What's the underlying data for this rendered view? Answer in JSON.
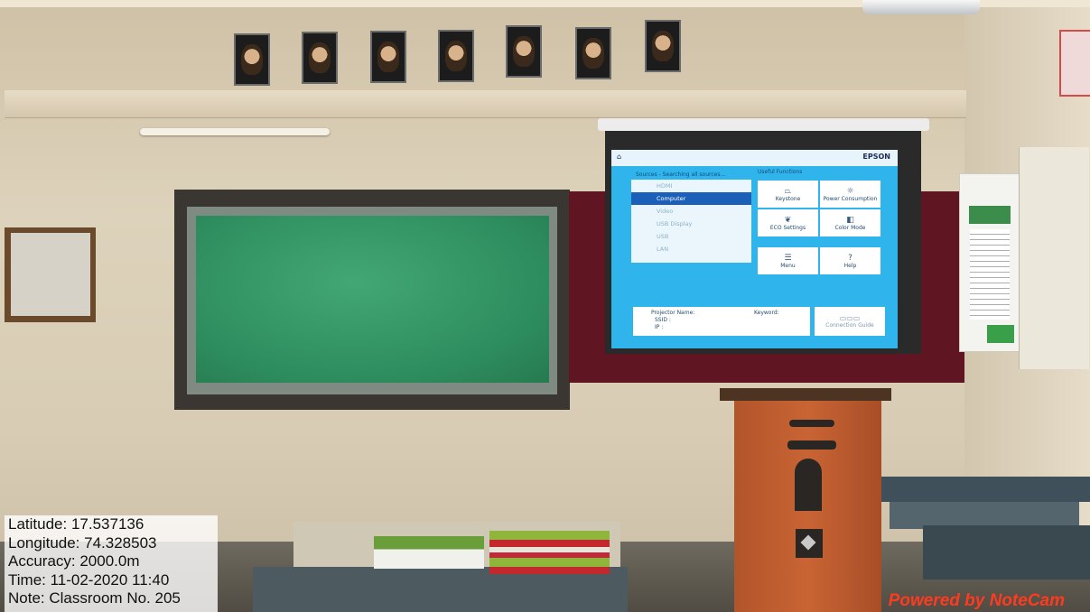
{
  "geotag": {
    "latitude": "Latitude: 17.537136",
    "longitude": "Longitude: 74.328503",
    "accuracy": "Accuracy: 2000.0m",
    "time": "Time: 11-02-2020 11:40",
    "note": "Note: Classroom  No. 205"
  },
  "watermark": "Powered by NoteCam",
  "projector": {
    "brand": "EPSON",
    "sources_heading": "Sources - Searching all sources...",
    "useful_heading": "Useful Functions",
    "sources": [
      {
        "label": "HDMI",
        "selected": false
      },
      {
        "label": "Computer",
        "selected": true
      },
      {
        "label": "Video",
        "selected": false
      },
      {
        "label": "USB Display",
        "selected": false
      },
      {
        "label": "USB",
        "selected": false
      },
      {
        "label": "LAN",
        "selected": false
      }
    ],
    "functions": [
      {
        "label": "Keystone",
        "icon": "keystone-icon"
      },
      {
        "label": "Power Consumption",
        "icon": "sun-icon"
      },
      {
        "label": "ECO Settings",
        "icon": "leaf-icon"
      },
      {
        "label": "Color Mode",
        "icon": "color-mode-icon"
      },
      {
        "label": "Menu",
        "icon": "menu-icon"
      },
      {
        "label": "Help",
        "icon": "help-icon"
      }
    ],
    "info": {
      "name_label": "Projector Name:",
      "keyword_label": "Keyword:",
      "ssid_label": "SSID :",
      "ip_label": "IP :"
    },
    "connection_guide": "Connection Guide"
  },
  "colors": {
    "screen_blue": "#2fb4ec",
    "selected_source": "#1b5fb8",
    "chalkboard_green": "#2d8c5d",
    "podium_orange": "#c96434",
    "watermark_red": "#ff3a1f"
  }
}
